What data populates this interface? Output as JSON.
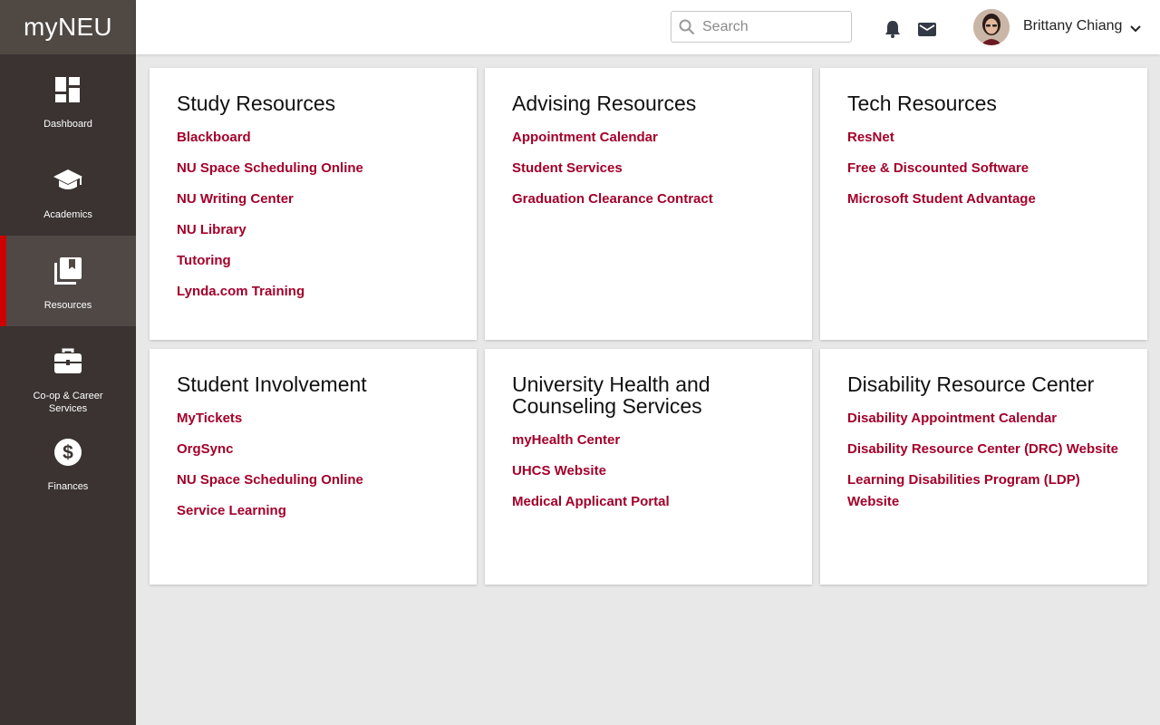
{
  "app": {
    "logo": "myNEU"
  },
  "sidebar": {
    "items": [
      {
        "label": "Dashboard",
        "icon": "dashboard-icon"
      },
      {
        "label": "Academics",
        "icon": "graduation-cap-icon"
      },
      {
        "label": "Resources",
        "icon": "resources-icon",
        "active": true
      },
      {
        "label": "Co-op & Career Services",
        "icon": "briefcase-icon"
      },
      {
        "label": "Finances",
        "icon": "dollar-icon"
      }
    ]
  },
  "header": {
    "search_placeholder": "Search",
    "user_name": "Brittany Chiang"
  },
  "colors": {
    "accent": "#a3002a",
    "active_bar": "#cc0000",
    "sidebar": "#3a3332"
  },
  "cards": [
    {
      "title": "Study Resources",
      "links": [
        "Blackboard",
        "NU Space Scheduling Online",
        "NU Writing Center",
        "NU Library",
        "Tutoring",
        "Lynda.com Training"
      ]
    },
    {
      "title": "Advising Resources",
      "links": [
        "Appointment Calendar",
        "Student Services",
        "Graduation Clearance Contract"
      ]
    },
    {
      "title": "Tech Resources",
      "links": [
        "ResNet",
        "Free & Discounted Software",
        "Microsoft Student Advantage"
      ]
    },
    {
      "title": "Student Involvement",
      "links": [
        "MyTickets",
        "OrgSync",
        "NU Space Scheduling Online",
        "Service Learning"
      ]
    },
    {
      "title": "University Health and Counseling Services",
      "links": [
        "myHealth Center",
        "UHCS Website",
        "Medical Applicant Portal"
      ]
    },
    {
      "title": "Disability Resource Center",
      "links": [
        "Disability Appointment Calendar",
        "Disability Resource Center (DRC) Website",
        "Learning Disabilities Program (LDP) Website"
      ]
    }
  ]
}
